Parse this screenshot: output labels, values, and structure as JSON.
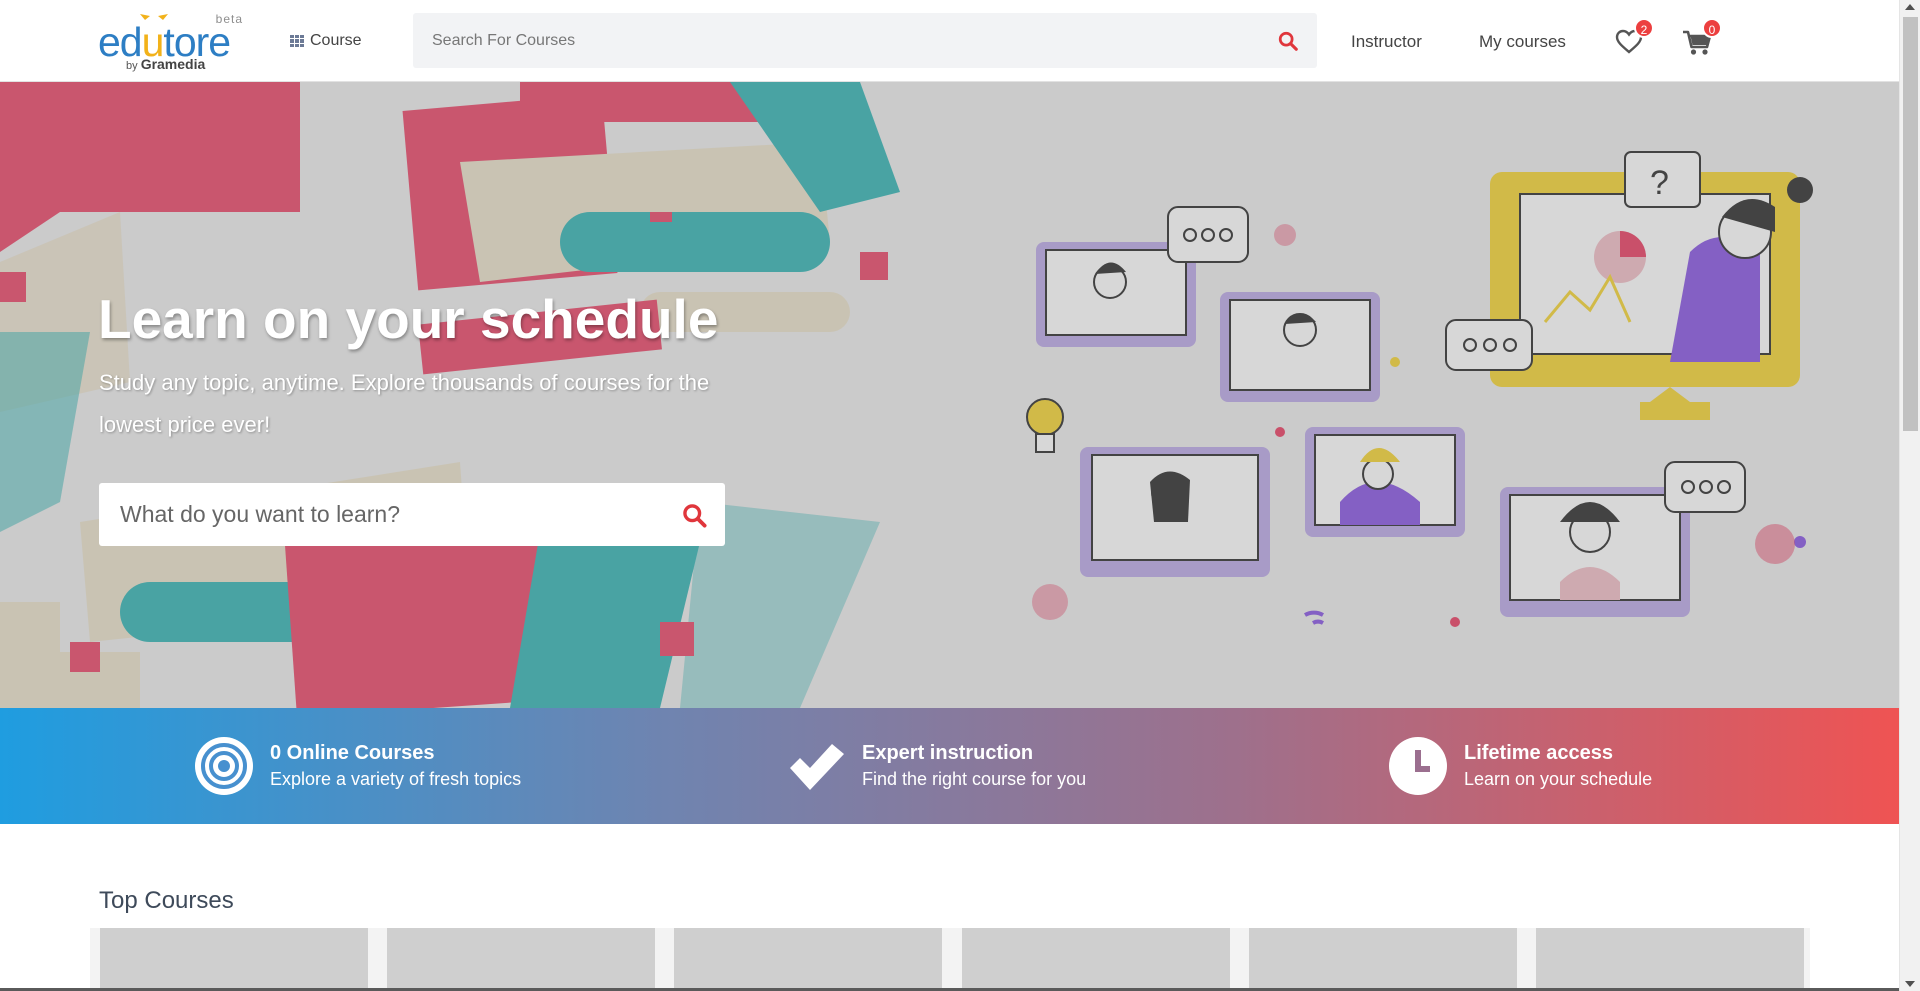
{
  "header": {
    "logo": {
      "word_start": "ed",
      "word_mid": "u",
      "word_end": "tore",
      "beta": "beta",
      "by": "by",
      "brand": "Gramedia"
    },
    "course_label": "Course",
    "search_placeholder": "Search For Courses",
    "instructor_label": "Instructor",
    "my_courses_label": "My courses",
    "wishlist_count": "2",
    "cart_count": "0"
  },
  "hero": {
    "title": "Learn on your schedule",
    "subtitle": "Study any topic, anytime. Explore thousands of courses for the lowest price ever!",
    "search_placeholder": "What do you want to learn?"
  },
  "features": [
    {
      "title": "0 Online Courses",
      "text": "Explore a variety of fresh topics",
      "icon": "target-icon"
    },
    {
      "title": "Expert instruction",
      "text": "Find the right course for you",
      "icon": "check-icon"
    },
    {
      "title": "Lifetime access",
      "text": "Learn on your schedule",
      "icon": "clock-icon"
    }
  ],
  "top_courses": {
    "title": "Top Courses"
  },
  "colors": {
    "brand_blue": "#2d7ec4",
    "brand_yellow": "#f2b21a",
    "accent_red": "#ec3f3f",
    "band_start": "#1f9de0",
    "band_end": "#ef5353"
  }
}
